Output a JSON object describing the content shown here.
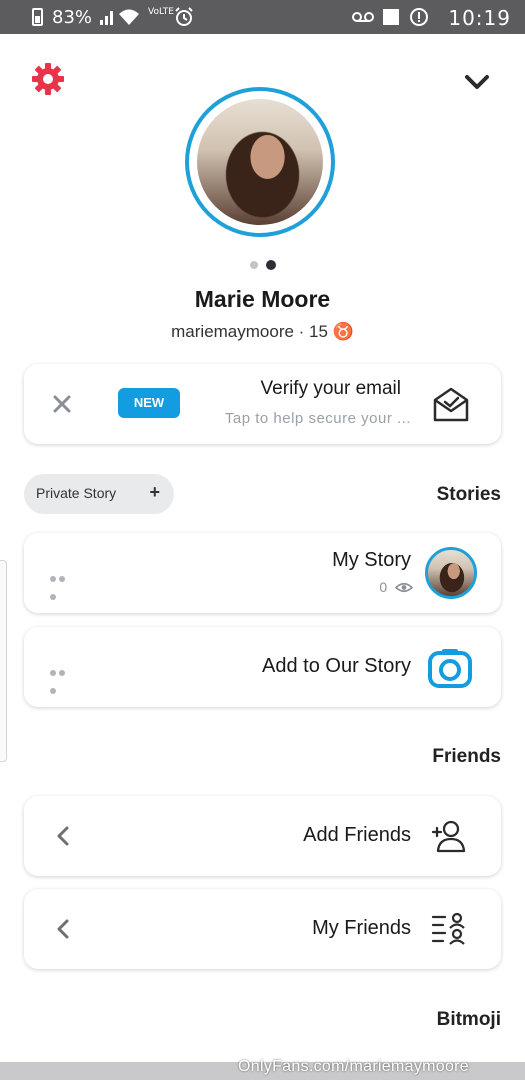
{
  "status_bar": {
    "time": "10:19",
    "battery": "83%",
    "network_label": "VoLTE"
  },
  "profile": {
    "name": "Marie Moore",
    "subtitle": "mariemaymoore · 15 ♉"
  },
  "verify": {
    "title": "Verify your email",
    "subtitle": "Tap to help secure your ...",
    "badge": "NEW"
  },
  "stories": {
    "title": "Stories",
    "private_story_label": "Private Story",
    "plus": "+",
    "my_story": {
      "title": "My Story",
      "views": "0"
    },
    "our_story": {
      "title": "Add to Our Story"
    }
  },
  "friends": {
    "title": "Friends",
    "add_friends": "Add Friends",
    "my_friends": "My Friends"
  },
  "bitmoji": {
    "title": "Bitmoji"
  },
  "watermark": "OnlyFans.com/mariemaymoore",
  "colors": {
    "accent_blue": "#139de0",
    "ring_blue": "#1fa0d8",
    "settings_red": "#e8334a",
    "status_bar": "#5c5c5e"
  }
}
